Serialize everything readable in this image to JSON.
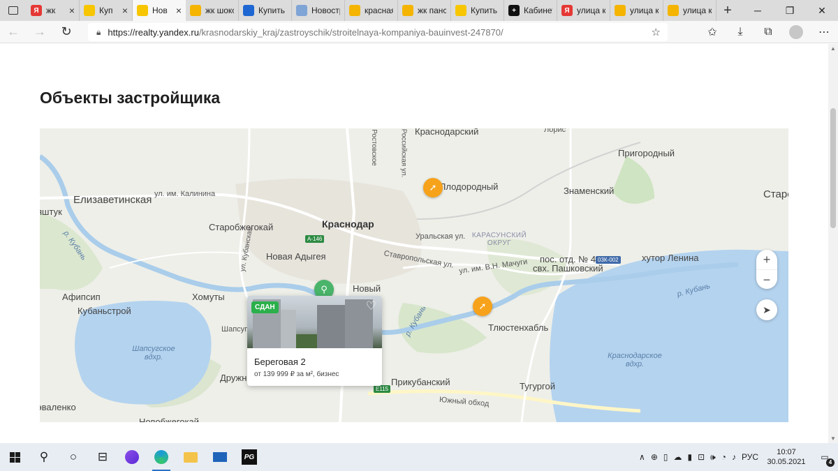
{
  "browser": {
    "tabs": [
      {
        "title": "жк",
        "favicon": "yandex-icon",
        "color": "#e53935",
        "glyph": "Я"
      },
      {
        "title": "Куп",
        "favicon": "realty-icon",
        "color": "#f7c600",
        "glyph": ""
      },
      {
        "title": "Нов",
        "favicon": "realty-icon",
        "color": "#f7c600",
        "glyph": "",
        "active": true
      },
      {
        "title": "жк шоко",
        "favicon": "images-icon",
        "color": "#f4b400",
        "glyph": ""
      },
      {
        "title": "Купить",
        "favicon": "avito-icon",
        "color": "#1e67d3",
        "glyph": ""
      },
      {
        "title": "Новостр",
        "favicon": "mail-icon",
        "color": "#7fa4d6",
        "glyph": ""
      },
      {
        "title": "красная",
        "favicon": "images-icon",
        "color": "#f4b400",
        "glyph": ""
      },
      {
        "title": "жк панс",
        "favicon": "images-icon",
        "color": "#f4b400",
        "glyph": ""
      },
      {
        "title": "Купить к",
        "favicon": "realty-icon",
        "color": "#f7c600",
        "glyph": ""
      },
      {
        "title": "Кабинет",
        "favicon": "plus-icon",
        "color": "#111111",
        "glyph": "+"
      },
      {
        "title": "улица ку",
        "favicon": "yandex-icon",
        "color": "#e53935",
        "glyph": "Я"
      },
      {
        "title": "улица ку",
        "favicon": "images-icon",
        "color": "#f4b400",
        "glyph": ""
      },
      {
        "title": "улица ку",
        "favicon": "images-icon",
        "color": "#f4b400",
        "glyph": ""
      }
    ],
    "url_base": "https://realty.yandex.ru",
    "url_rest": "/krasnodarskiy_kraj/zastroyschik/stroitelnaya-kompaniya-bauinvest-247870/"
  },
  "page": {
    "title": "Объекты застройщика"
  },
  "map": {
    "labels": {
      "krasnodarskiy": "Краснодарский",
      "loris": "Лорис",
      "prigorodny": "Пригородный",
      "plodorodny": "Плодородный",
      "znamensky": "Знаменский",
      "staro": "Старо",
      "elizavetinskaya": "Елизаветинская",
      "ul_kalinina": "ул. им. Калинина",
      "shtuk": "яштук",
      "starokorsunsky": "Старобжегокай",
      "krasnodar": "Краснодар",
      "uralskaya": "Уральская ул.",
      "karasunsky": "КАРАСУНСКИЙ ОКРУГ",
      "r_kuban_w": "р. Кубань",
      "novaya_adygeya": "Новая Адыгея",
      "stavropolskaya": "Ставропольская ул.",
      "machugi": "ул. им. В.Н. Мачуги",
      "pos_otd": "пос. отд. № 4",
      "svh_pashkovsky": "свх. Пашковский",
      "khutor_lenina": "хутор Ленина",
      "afipsip": "Афипсип",
      "khomuty": "Хомуты",
      "novy": "Новый",
      "r_kuban_e": "р. Кубань",
      "kubanstroy": "Кубаньстрой",
      "tlyustenkhabl": "Тлюстенхабль",
      "shapsug_vdhr": "Шапсугское вдхр.",
      "krasnodarskoe_vdhr": "Краснодарское вдхр.",
      "druzhny": "Дружн",
      "prikubansky": "Прикубанский",
      "tugurgoy": "Тугургой",
      "yuzhny_obhod": "Южный обход",
      "valenko": "эваленко",
      "novobzhegokay": "Новобжегокай",
      "shapsug": "Шапсуг",
      "rostovskoe": "Ростовское",
      "rossiyskaya": "Российская ул.",
      "ul_k": "ул. Кубанская",
      "r_kuban_mid": "р. Кубань"
    },
    "badges": {
      "a146": "А-146",
      "r03k": "03К-002",
      "e115": "Е115"
    },
    "zoom_in": "+",
    "zoom_out": "−",
    "card": {
      "badge": "СДАН",
      "name": "Береговая 2",
      "price": "от 139 999 ₽ за м², бизнес"
    }
  },
  "taskbar": {
    "lang": "РУС",
    "time": "10:07",
    "date": "30.05.2021",
    "notifications": "4",
    "pg_label": "PG"
  }
}
